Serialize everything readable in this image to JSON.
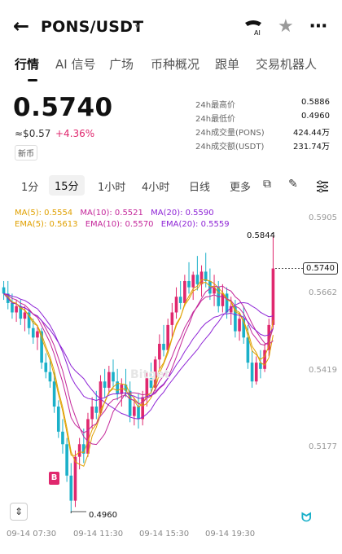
{
  "header": {
    "back_glyph": "←",
    "pair": "PONS/USDT",
    "caret_glyph": "▾",
    "ai_label": "AI",
    "star_glyph": "★",
    "more_glyph": "⋯"
  },
  "tabs": [
    {
      "label": "行情",
      "active": true
    },
    {
      "label": "AI 信号",
      "active": false
    },
    {
      "label": "广场",
      "active": false
    },
    {
      "label": "币种概况",
      "active": false
    },
    {
      "label": "跟单",
      "active": false
    },
    {
      "label": "交易机器人",
      "active": false
    }
  ],
  "ticker": {
    "price": "0.5740",
    "fiat": "≈$0.57",
    "change": "+4.36%",
    "badge": "新币"
  },
  "stats": [
    {
      "label": "24h最高价",
      "value": "0.5886"
    },
    {
      "label": "24h最低价",
      "value": "0.4960"
    },
    {
      "label": "24h成交量(PONS)",
      "value": "424.44万"
    },
    {
      "label": "24h成交额(USDT)",
      "value": "231.74万"
    }
  ],
  "intervals": [
    {
      "label": "1分",
      "active": false
    },
    {
      "label": "15分",
      "active": true
    },
    {
      "label": "1小时",
      "active": false
    },
    {
      "label": "4小时",
      "active": false
    },
    {
      "label": "日线",
      "active": false
    },
    {
      "label": "更多",
      "active": false
    }
  ],
  "tools": {
    "indicator_glyph": "⧉",
    "draw_glyph": "✎"
  },
  "ma_legend": {
    "ma5": "MA(5): 0.5554",
    "ma10": "MA(10): 0.5521",
    "ma20": "MA(20): 0.5590",
    "ema5": "EMA(5): 0.5613",
    "ema10": "EMA(10): 0.5570",
    "ema20": "EMA(20): 0.5559"
  },
  "colors": {
    "up": "#e0286e",
    "down": "#1ab0c9",
    "ma5": "#e0a000",
    "ma10": "#c4279a",
    "ma20": "#8e24d6"
  },
  "chart_data": {
    "type": "candlestick",
    "y_ticks": [
      "0.5905",
      "0.5662",
      "0.5419",
      "0.5177"
    ],
    "x_ticks": [
      "09-14 07:30",
      "09-14 11:30",
      "09-14 15:30",
      "09-14 19:30"
    ],
    "last_price_tag": "0.5740",
    "high_label": "0.5844",
    "low_label": "0.4960",
    "buy_marker": "B",
    "ylim": [
      0.496,
      0.5905
    ],
    "candles": [
      [
        0.568,
        0.57,
        0.564,
        0.566
      ],
      [
        0.566,
        0.57,
        0.561,
        0.563
      ],
      [
        0.563,
        0.566,
        0.558,
        0.56
      ],
      [
        0.56,
        0.564,
        0.557,
        0.562
      ],
      [
        0.562,
        0.564,
        0.556,
        0.558
      ],
      [
        0.558,
        0.562,
        0.554,
        0.56
      ],
      [
        0.56,
        0.561,
        0.553,
        0.555
      ],
      [
        0.555,
        0.558,
        0.55,
        0.552
      ],
      [
        0.552,
        0.556,
        0.548,
        0.554
      ],
      [
        0.554,
        0.555,
        0.542,
        0.544
      ],
      [
        0.544,
        0.547,
        0.539,
        0.541
      ],
      [
        0.541,
        0.545,
        0.536,
        0.538
      ],
      [
        0.538,
        0.541,
        0.528,
        0.53
      ],
      [
        0.53,
        0.532,
        0.52,
        0.522
      ],
      [
        0.522,
        0.526,
        0.515,
        0.518
      ],
      [
        0.518,
        0.52,
        0.506,
        0.508
      ],
      [
        0.508,
        0.512,
        0.496,
        0.5
      ],
      [
        0.5,
        0.516,
        0.498,
        0.514
      ],
      [
        0.514,
        0.52,
        0.51,
        0.518
      ],
      [
        0.518,
        0.523,
        0.512,
        0.515
      ],
      [
        0.515,
        0.528,
        0.514,
        0.526
      ],
      [
        0.526,
        0.533,
        0.523,
        0.53
      ],
      [
        0.53,
        0.535,
        0.526,
        0.528
      ],
      [
        0.528,
        0.54,
        0.527,
        0.538
      ],
      [
        0.538,
        0.542,
        0.533,
        0.536
      ],
      [
        0.536,
        0.543,
        0.534,
        0.541
      ],
      [
        0.541,
        0.545,
        0.536,
        0.538
      ],
      [
        0.538,
        0.542,
        0.532,
        0.534
      ],
      [
        0.534,
        0.539,
        0.53,
        0.537
      ],
      [
        0.537,
        0.542,
        0.533,
        0.535
      ],
      [
        0.535,
        0.538,
        0.525,
        0.527
      ],
      [
        0.527,
        0.533,
        0.524,
        0.53
      ],
      [
        0.53,
        0.534,
        0.523,
        0.526
      ],
      [
        0.526,
        0.535,
        0.524,
        0.533
      ],
      [
        0.533,
        0.541,
        0.53,
        0.539
      ],
      [
        0.539,
        0.544,
        0.534,
        0.536
      ],
      [
        0.536,
        0.546,
        0.535,
        0.545
      ],
      [
        0.545,
        0.553,
        0.542,
        0.55
      ],
      [
        0.55,
        0.556,
        0.546,
        0.548
      ],
      [
        0.548,
        0.558,
        0.547,
        0.556
      ],
      [
        0.556,
        0.563,
        0.552,
        0.56
      ],
      [
        0.56,
        0.568,
        0.558,
        0.565
      ],
      [
        0.565,
        0.57,
        0.561,
        0.563
      ],
      [
        0.563,
        0.572,
        0.562,
        0.57
      ],
      [
        0.57,
        0.576,
        0.566,
        0.568
      ],
      [
        0.568,
        0.573,
        0.564,
        0.572
      ],
      [
        0.572,
        0.578,
        0.567,
        0.569
      ],
      [
        0.569,
        0.575,
        0.565,
        0.573
      ],
      [
        0.573,
        0.579,
        0.568,
        0.57
      ],
      [
        0.57,
        0.574,
        0.564,
        0.566
      ],
      [
        0.566,
        0.572,
        0.562,
        0.568
      ],
      [
        0.568,
        0.57,
        0.56,
        0.562
      ],
      [
        0.562,
        0.569,
        0.56,
        0.566
      ],
      [
        0.566,
        0.568,
        0.558,
        0.56
      ],
      [
        0.56,
        0.565,
        0.556,
        0.562
      ],
      [
        0.562,
        0.564,
        0.552,
        0.554
      ],
      [
        0.554,
        0.56,
        0.551,
        0.558
      ],
      [
        0.558,
        0.562,
        0.55,
        0.552
      ],
      [
        0.552,
        0.556,
        0.542,
        0.544
      ],
      [
        0.544,
        0.548,
        0.536,
        0.538
      ],
      [
        0.538,
        0.546,
        0.537,
        0.544
      ],
      [
        0.544,
        0.548,
        0.539,
        0.542
      ],
      [
        0.542,
        0.55,
        0.541,
        0.548
      ],
      [
        0.548,
        0.558,
        0.546,
        0.556
      ],
      [
        0.556,
        0.5844,
        0.555,
        0.574
      ]
    ]
  },
  "watermark": "Bitget",
  "expand_glyph": "⇕",
  "mascot_glyph": "ᗢ"
}
